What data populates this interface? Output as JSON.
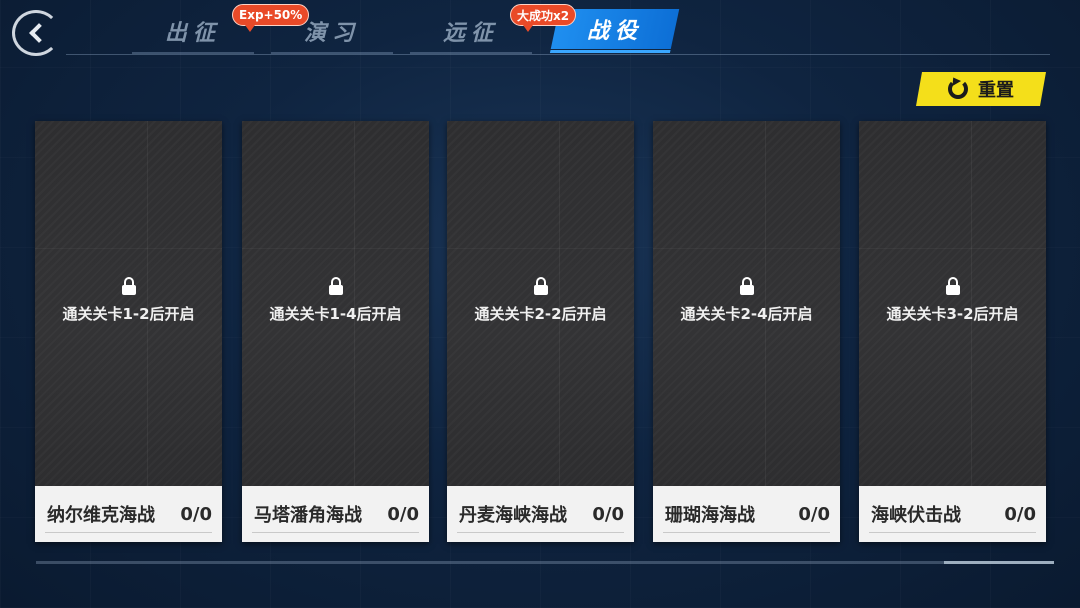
{
  "tabs": [
    {
      "label": "出征",
      "active": false
    },
    {
      "label": "演习",
      "active": false
    },
    {
      "label": "远征",
      "active": false
    },
    {
      "label": "战役",
      "active": true
    }
  ],
  "badges": {
    "exp": "Exp+50%",
    "success": "大成功x2"
  },
  "reset_label": "重置",
  "cards": [
    {
      "unlock_text": "通关关卡1-2后开启",
      "name": "纳尔维克海战",
      "progress": "0/0"
    },
    {
      "unlock_text": "通关关卡1-4后开启",
      "name": "马塔潘角海战",
      "progress": "0/0"
    },
    {
      "unlock_text": "通关关卡2-2后开启",
      "name": "丹麦海峡海战",
      "progress": "0/0"
    },
    {
      "unlock_text": "通关关卡2-4后开启",
      "name": "珊瑚海海战",
      "progress": "0/0"
    },
    {
      "unlock_text": "通关关卡3-2后开启",
      "name": "海峡伏击战",
      "progress": "0/0"
    }
  ],
  "icons": {
    "back": "chevron-left-icon",
    "reset": "refresh-icon",
    "lock": "lock-icon"
  },
  "colors": {
    "active_tab": "#1f8ff0",
    "reset_button": "#f4df1a",
    "badge": "#e94a28"
  }
}
